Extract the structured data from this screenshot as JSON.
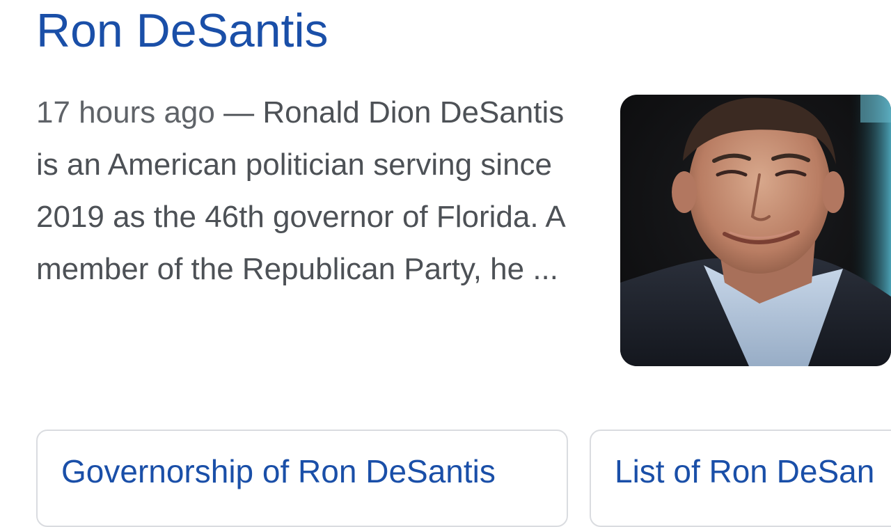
{
  "result": {
    "title": "Ron DeSantis",
    "date": "17 hours ago",
    "separator": " — ",
    "snippet": "Ronald Dion DeSantis is an American politician serving since 2019 as the 46th governor of Florida. A member of the Republican Party, he ...",
    "thumbnail_alt": "Photo of Ron DeSantis"
  },
  "related_links": [
    {
      "label": "Governorship of Ron DeSantis"
    },
    {
      "label": "List of Ron DeSan"
    }
  ],
  "colors": {
    "link": "#1a4fa8",
    "text": "#4d5156",
    "chip_border": "#dadce0"
  }
}
